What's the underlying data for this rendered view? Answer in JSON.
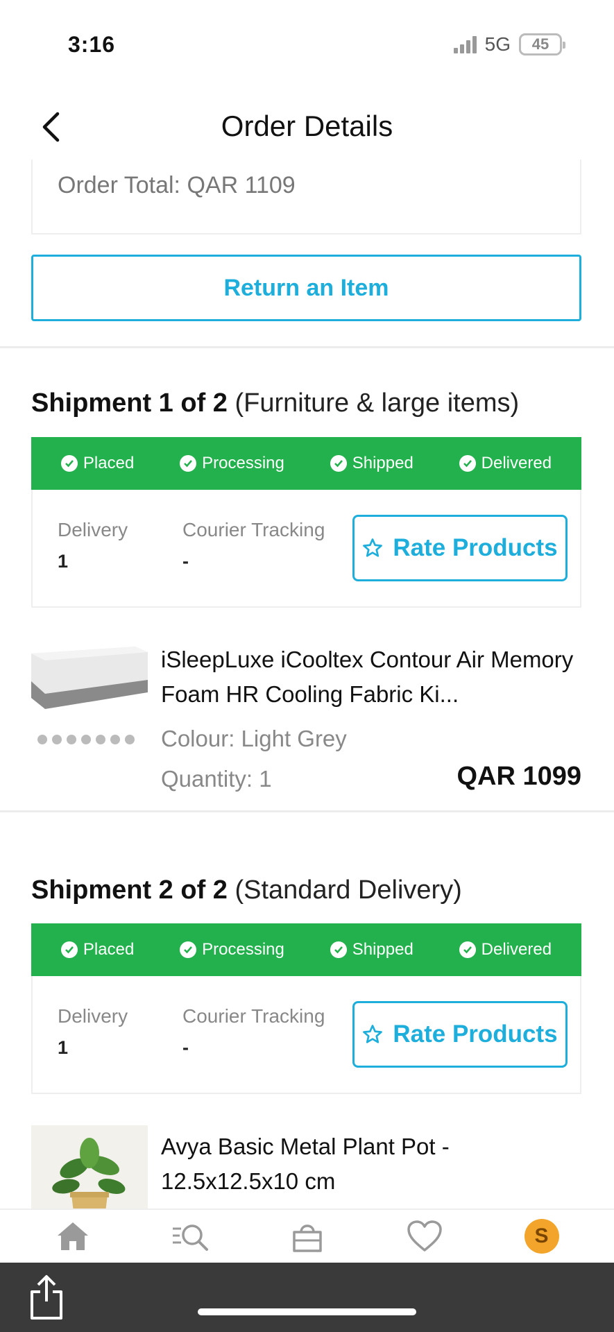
{
  "status_bar": {
    "time": "3:16",
    "network": "5G",
    "battery": "45"
  },
  "header": {
    "title": "Order Details"
  },
  "order": {
    "total_text": "Order Total: QAR 1109",
    "return_label": "Return an Item"
  },
  "shipments": [
    {
      "title_bold": "Shipment 1 of 2",
      "title_sub": "(Furniture & large items)",
      "steps": [
        "Placed",
        "Processing",
        "Shipped",
        "Delivered"
      ],
      "delivery_label": "Delivery",
      "delivery_value": "1",
      "tracking_label": "Courier Tracking",
      "tracking_value": "-",
      "rate_label": "Rate Products",
      "product": {
        "name": "iSleepLuxe iCooltex Contour Air Memory Foam HR Cooling Fabric Ki...",
        "colour": "Colour: Light Grey",
        "quantity": "Quantity: 1",
        "price": "QAR 1099"
      }
    },
    {
      "title_bold": "Shipment 2 of 2",
      "title_sub": "(Standard Delivery)",
      "steps": [
        "Placed",
        "Processing",
        "Shipped",
        "Delivered"
      ],
      "delivery_label": "Delivery",
      "delivery_value": "1",
      "tracking_label": "Courier Tracking",
      "tracking_value": "-",
      "rate_label": "Rate Products",
      "product": {
        "name": "Avya Basic Metal Plant Pot - 12.5x12.5x10 cm"
      }
    }
  ],
  "bottom_nav": {
    "items": [
      "home-icon",
      "search-icon",
      "bag-icon",
      "heart-icon",
      "coin-icon"
    ],
    "coin_symbol": "S"
  },
  "colors": {
    "accent": "#1eaedb",
    "status_green": "#22b14c"
  }
}
